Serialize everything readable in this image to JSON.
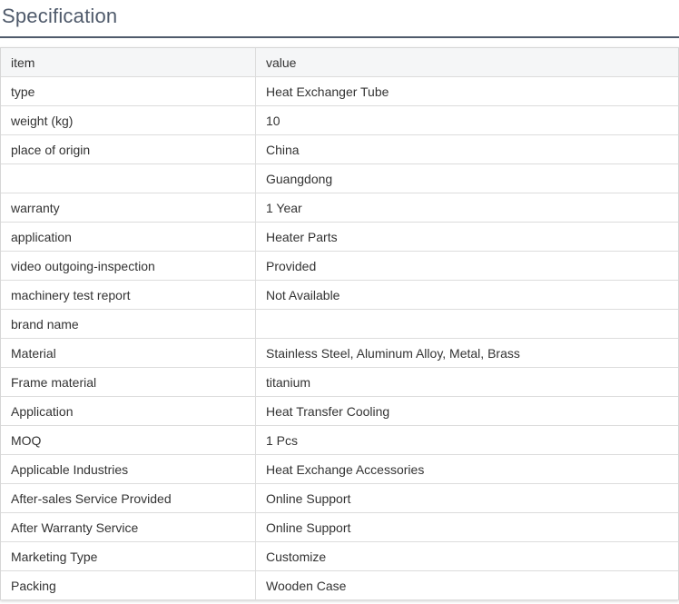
{
  "section": {
    "title": "Specification"
  },
  "table": {
    "header": {
      "key": "item",
      "value": "value"
    },
    "rows": [
      {
        "key": "type",
        "value": "Heat Exchanger Tube"
      },
      {
        "key": "weight (kg)",
        "value": "10"
      },
      {
        "key": "place of origin",
        "value": "China"
      },
      {
        "key": "",
        "value": "Guangdong"
      },
      {
        "key": "warranty",
        "value": "1 Year"
      },
      {
        "key": "application",
        "value": "Heater Parts"
      },
      {
        "key": "video outgoing-inspection",
        "value": "Provided"
      },
      {
        "key": "machinery test report",
        "value": "Not Available"
      },
      {
        "key": "brand name",
        "value": ""
      },
      {
        "key": "Material",
        "value": "Stainless Steel, Aluminum Alloy, Metal, Brass"
      },
      {
        "key": "Frame material",
        "value": "titanium"
      },
      {
        "key": "Application",
        "value": "Heat Transfer Cooling"
      },
      {
        "key": "MOQ",
        "value": "1 Pcs"
      },
      {
        "key": "Applicable Industries",
        "value": "Heat Exchange Accessories"
      },
      {
        "key": "After-sales Service Provided",
        "value": "Online Support"
      },
      {
        "key": "After Warranty Service",
        "value": "Online Support"
      },
      {
        "key": "Marketing Type",
        "value": "Customize"
      },
      {
        "key": "Packing",
        "value": "Wooden Case"
      }
    ]
  }
}
